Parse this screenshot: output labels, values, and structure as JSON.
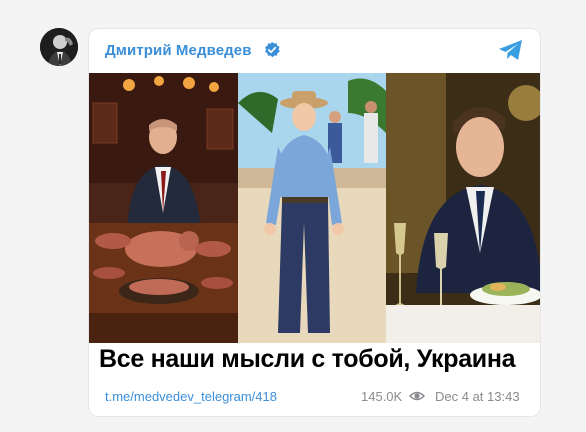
{
  "channel": {
    "name": "Дмитрий Медведев",
    "verified": true,
    "accent_color": "#3a8fd8"
  },
  "post": {
    "caption": "Все наши мысли с тобой, Украина",
    "link": "t.me/medvedev_telegram/418",
    "views": "145.0K",
    "date": "Dec 4 at 13:43"
  },
  "icons": {
    "avatar": "channel-avatar",
    "verified": "verified-badge-icon",
    "telegram": "telegram-plane-icon",
    "views": "eye-icon"
  }
}
